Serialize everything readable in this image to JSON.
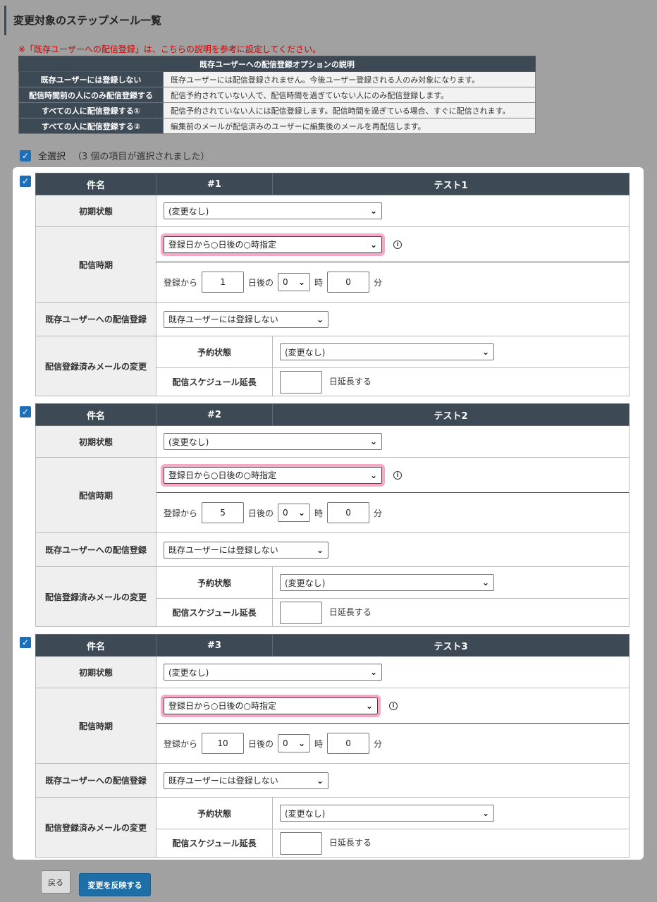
{
  "page": {
    "title": "変更対象のステップメール一覧"
  },
  "notice": "※「既存ユーザーへの配信登録」は、こちらの説明を参考に設定してください。",
  "options_table": {
    "caption": "既存ユーザーへの配信登録オプションの説明",
    "rows": [
      {
        "name": "既存ユーザーには登録しない",
        "desc": "既存ユーザーには配信登録されません。今後ユーザー登録される人のみ対象になります。"
      },
      {
        "name": "配信時間前の人にのみ配信登録する",
        "desc": "配信予約されていない人で、配信時間を過ぎていない人にのみ配信登録します。"
      },
      {
        "name": "すべての人に配信登録する①",
        "desc": "配信予約されていない人には配信登録します。配信時間を過ぎている場合、すぐに配信されます。"
      },
      {
        "name": "すべての人に配信登録する②",
        "desc": "編集前のメールが配信済みのユーザーに編集後のメールを再配信します。"
      }
    ]
  },
  "select_all": {
    "label": "全選択",
    "count_text": "（3 個の項目が選択されました）"
  },
  "labels": {
    "subject": "件名",
    "initial_state": "初期状態",
    "delivery_timing": "配信時期",
    "existing_users": "既存ユーザーへの配信登録",
    "sent_mail_change": "配信登録済みメールの変更",
    "reservation_state": "予約状態",
    "schedule_extend": "配信スケジュール延長",
    "from_reg": "登録から",
    "days_after": "日後の",
    "hour": "時",
    "minute": "分",
    "extend_days": "日延長する"
  },
  "items": [
    {
      "checked": true,
      "num": "#1",
      "name": "テスト1",
      "initial_state": "(変更なし)",
      "timing": "登録日から○日後の○時指定",
      "days": "1",
      "hour": "0",
      "minute": "0",
      "existing": "既存ユーザーには登録しない",
      "reservation": "(変更なし)",
      "extend": ""
    },
    {
      "checked": true,
      "num": "#2",
      "name": "テスト2",
      "initial_state": "(変更なし)",
      "timing": "登録日から○日後の○時指定",
      "days": "5",
      "hour": "0",
      "minute": "0",
      "existing": "既存ユーザーには登録しない",
      "reservation": "(変更なし)",
      "extend": ""
    },
    {
      "checked": true,
      "num": "#3",
      "name": "テスト3",
      "initial_state": "(変更なし)",
      "timing": "登録日から○日後の○時指定",
      "days": "10",
      "hour": "0",
      "minute": "0",
      "existing": "既存ユーザーには登録しない",
      "reservation": "(変更なし)",
      "extend": ""
    }
  ],
  "buttons": {
    "back": "戻る",
    "apply": "変更を反映する"
  },
  "colors": {
    "header_dark": "#3d4a56",
    "highlight": "#f7a8c8",
    "checkbox": "#1e6fb8",
    "notice": "#cc0000",
    "apply_button": "#1e6fa8"
  }
}
